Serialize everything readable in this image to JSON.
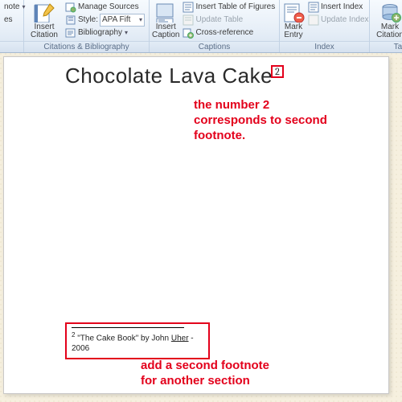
{
  "ribbon": {
    "partial_left": {
      "note_lbl": "note",
      "es_lbl": "es"
    },
    "citations": {
      "insert_citation": "Insert\nCitation",
      "manage_sources": "Manage Sources",
      "style_label": "Style:",
      "style_value": "APA Fift",
      "bibliography": "Bibliography",
      "group_label": "Citations & Bibliography"
    },
    "captions": {
      "insert_caption": "Insert\nCaption",
      "insert_tof": "Insert Table of Figures",
      "update_table": "Update Table",
      "cross_reference": "Cross-reference",
      "group_label": "Captions"
    },
    "index": {
      "mark_entry": "Mark\nEntry",
      "insert_index": "Insert Index",
      "update_index": "Update Index",
      "group_label": "Index"
    },
    "toa": {
      "mark_citation": "Mark\nCitation",
      "group_label": "Tabl"
    }
  },
  "doc": {
    "title_a": "Chocolate  Lava Cake",
    "footnum": "2",
    "footnote_marker": "2",
    "footnote_pre": " \"The Cake Book\" by John ",
    "footnote_uline": "Uher",
    "footnote_post": " - 2006"
  },
  "annot": {
    "top": "the number 2\ncorresponds to second\nfootnote.",
    "bottom": "add a second footnote\nfor another section"
  }
}
